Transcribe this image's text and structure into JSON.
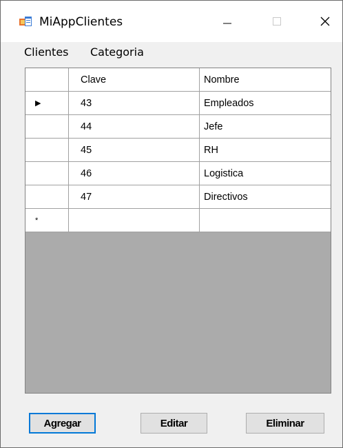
{
  "window": {
    "title": "MiAppClientes",
    "app_icon": "winforms-app-icon",
    "controls": {
      "minimize": "minimize-icon",
      "maximize": "maximize-icon",
      "close": "close-icon"
    }
  },
  "menu": {
    "items": [
      "Clientes",
      "Categoria"
    ]
  },
  "grid": {
    "columns": [
      "Clave",
      "Nombre"
    ],
    "rows": [
      {
        "selector": "▶",
        "clave": "43",
        "nombre": "Empleados"
      },
      {
        "selector": "",
        "clave": "44",
        "nombre": "Jefe"
      },
      {
        "selector": "",
        "clave": "45",
        "nombre": "RH"
      },
      {
        "selector": "",
        "clave": "46",
        "nombre": "Logistica"
      },
      {
        "selector": "",
        "clave": "47",
        "nombre": "Directivos"
      }
    ],
    "new_row": {
      "selector": "*",
      "clave": "",
      "nombre": ""
    }
  },
  "buttons": {
    "agregar": "Agregar",
    "editar": "Editar",
    "eliminar": "Eliminar"
  },
  "colors": {
    "focus_border": "#0078d7",
    "grid_background": "#ababab"
  }
}
